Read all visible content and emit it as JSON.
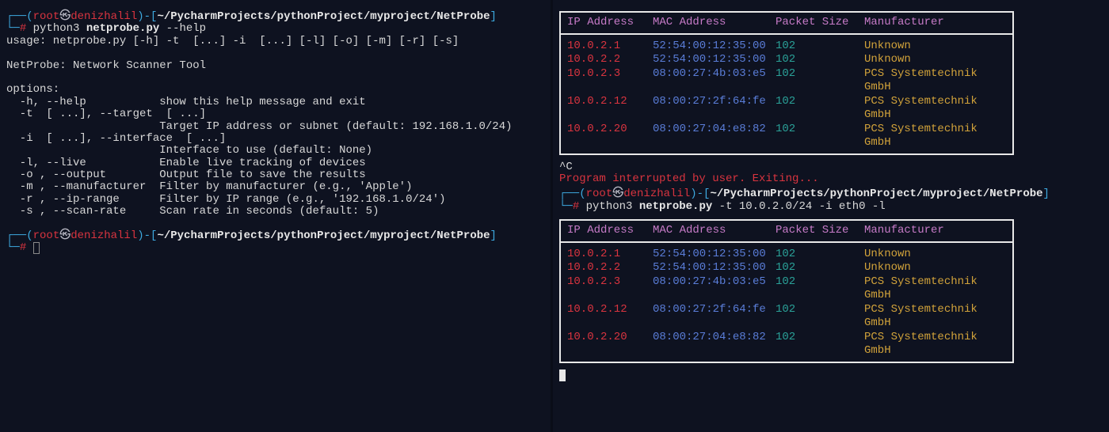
{
  "prompt": {
    "open": "┌──(",
    "close": ")-[",
    "end": "]",
    "user": "root",
    "at": "㉿",
    "host": "denizhalil",
    "path": "~/PycharmProjects/pythonProject/myproject/NetProbe",
    "ps2": "└─",
    "hash": "#"
  },
  "left": {
    "cmd1": {
      "prog": "python3 ",
      "file": "netprobe.py",
      "args": " --help"
    },
    "help": {
      "usage": "usage: netprobe.py [-h] -t  [...] -i  [...] [-l] [-o] [-m] [-r] [-s]",
      "title": "NetProbe: Network Scanner Tool",
      "options_hdr": "options:",
      "opts": [
        "  -h, --help           show this help message and exit",
        "  -t  [ ...], --target  [ ...]",
        "                       Target IP address or subnet (default: 192.168.1.0/24)",
        "  -i  [ ...], --interface  [ ...]",
        "                       Interface to use (default: None)",
        "  -l, --live           Enable live tracking of devices",
        "  -o , --output        Output file to save the results",
        "  -m , --manufacturer  Filter by manufacturer (e.g., 'Apple')",
        "  -r , --ip-range      Filter by IP range (e.g., '192.168.1.0/24')",
        "  -s , --scan-rate     Scan rate in seconds (default: 5)"
      ]
    }
  },
  "right": {
    "interrupt_sig": "^C",
    "interrupt_msg": "Program interrupted by user. Exiting...",
    "cmd2": {
      "prog": "python3 ",
      "file": "netprobe.py",
      "args1": " -t 10.0.2.0/24 -i eth0 ",
      "args2": "-l"
    }
  },
  "table": {
    "headers": {
      "ip": "IP Address",
      "mac": "MAC Address",
      "pkt": "Packet Size",
      "mfr": "Manufacturer"
    },
    "rows": [
      {
        "ip": "10.0.2.1",
        "mac": "52:54:00:12:35:00",
        "pkt": "102",
        "mfr": "Unknown"
      },
      {
        "ip": "10.0.2.2",
        "mac": "52:54:00:12:35:00",
        "pkt": "102",
        "mfr": "Unknown"
      },
      {
        "ip": "10.0.2.3",
        "mac": "08:00:27:4b:03:e5",
        "pkt": "102",
        "mfr": "PCS Systemtechnik GmbH"
      },
      {
        "ip": "10.0.2.12",
        "mac": "08:00:27:2f:64:fe",
        "pkt": "102",
        "mfr": "PCS Systemtechnik GmbH"
      },
      {
        "ip": "10.0.2.20",
        "mac": "08:00:27:04:e8:82",
        "pkt": "102",
        "mfr": "PCS Systemtechnik GmbH"
      }
    ]
  }
}
